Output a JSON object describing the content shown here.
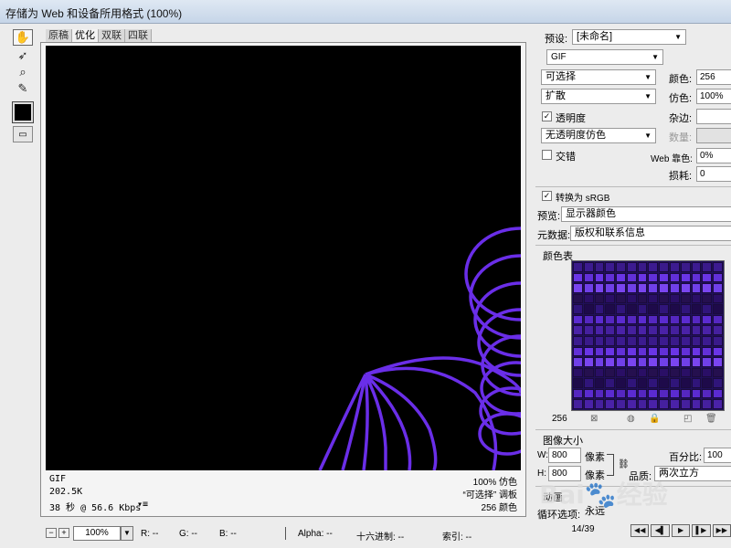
{
  "window": {
    "title": "存储为 Web 和设备所用格式 (100%)"
  },
  "tools": [
    {
      "name": "hand-tool",
      "glyph": "✋"
    },
    {
      "name": "slice-select-tool",
      "glyph": "➶"
    },
    {
      "name": "zoom-tool",
      "glyph": "🔍"
    },
    {
      "name": "eyedropper-tool",
      "glyph": "✎"
    }
  ],
  "tabs": [
    "原稿",
    "优化",
    "双联",
    "四联"
  ],
  "info": {
    "format": "GIF",
    "size": "202.5K",
    "time": "38 秒 @ 56.6 Kbps",
    "time_menu": "▾≡",
    "dither": "100% 仿色",
    "palette": "“可选择” 调板",
    "colors": "256 颜色"
  },
  "status": {
    "zoom": "100%",
    "r": "R: --",
    "g": "G: --",
    "b": "B: --",
    "alpha": "Alpha: --",
    "hex": "十六进制: --",
    "index": "索引: --"
  },
  "settings": {
    "preset_label": "预设:",
    "preset_value": "[未命名]",
    "format_value": "GIF",
    "reduction_value": "可选择",
    "colors_label": "颜色:",
    "colors_value": "256",
    "dither_value": "扩散",
    "dither_label": "仿色:",
    "dither_amount": "100%",
    "transparency_label": "透明度",
    "matte_label": "杂边:",
    "trans_dither_value": "无透明度仿色",
    "amount_label": "数量:",
    "interlace_label": "交错",
    "web_snap_label": "Web 靠色:",
    "web_snap_value": "0%",
    "lossy_label": "损耗:",
    "lossy_value": "0",
    "convert_srgb_label": "转换为 sRGB",
    "preview_label": "预览:",
    "preview_value": "显示器颜色",
    "metadata_label": "元数据:",
    "metadata_value": "版权和联系信息"
  },
  "color_table": {
    "title": "颜色表",
    "count": "256",
    "colors": [
      "#3a1a8a",
      "#5b2bd0",
      "#2a0f66",
      "#6a35e6",
      "#4a22a8",
      "#1e0a4a",
      "#7a45f0",
      "#3c1b90",
      "#5527c0",
      "#25104f",
      "#6230d8",
      "#45209e",
      "#30157a",
      "#7040e8"
    ]
  },
  "image_size": {
    "title": "图像大小",
    "w_label": "W:",
    "w_value": "800",
    "h_label": "H:",
    "h_value": "800",
    "unit": "像素",
    "percent_label": "百分比:",
    "percent_value": "100",
    "quality_label": "品质:",
    "quality_value": "两次立方"
  },
  "animation": {
    "title": "动画",
    "loop_label": "循环选项:",
    "loop_value": "永远",
    "frame_counter": "14/39"
  },
  "watermark": "Bai🐾经验",
  "accent_color": "#6a2ee8"
}
